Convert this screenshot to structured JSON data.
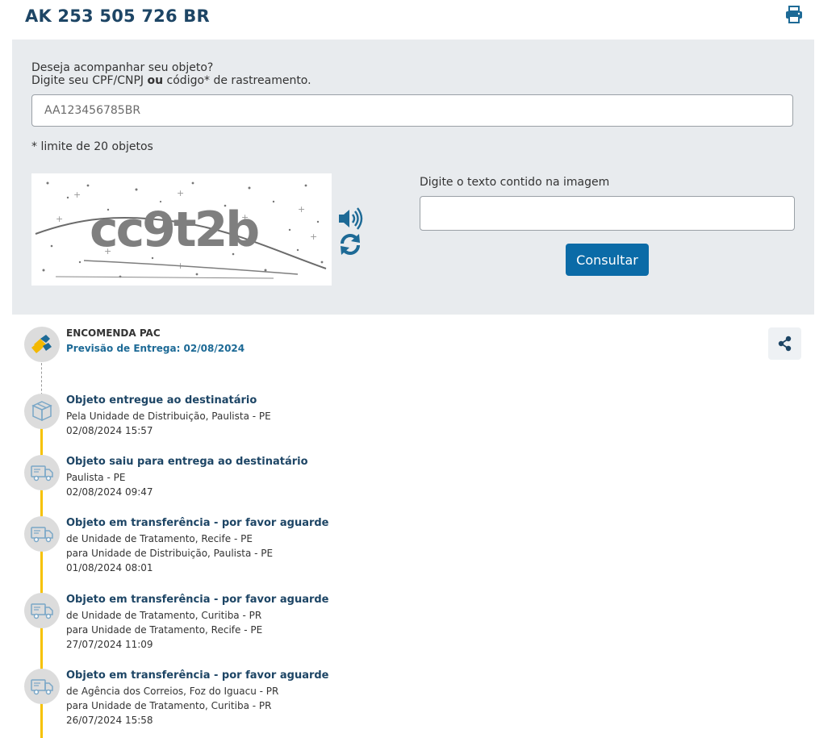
{
  "header": {
    "tracking_code": "AK 253 505 726 BR"
  },
  "search": {
    "prompt_line1": "Deseja acompanhar seu objeto?",
    "prompt_line2_pre": "Digite seu CPF/CNPJ ",
    "prompt_line2_bold": "ou",
    "prompt_line2_post": " código* de rastreamento.",
    "placeholder": "AA123456785BR",
    "limit_note": "* limite de 20 objetos",
    "captcha_text": "cc9t2b",
    "captcha_label": "Digite o texto contido na imagem",
    "consult_label": "Consultar"
  },
  "shipment": {
    "service": "ENCOMENDA PAC",
    "forecast": "Previsão de Entrega: 02/08/2024"
  },
  "events": [
    {
      "title": "Objeto entregue ao destinatário",
      "icon": "delivered-box-icon",
      "lines": [
        "Pela Unidade de Distribuição, Paulista - PE"
      ],
      "datetime": "02/08/2024 15:57"
    },
    {
      "title": "Objeto saiu para entrega ao destinatário",
      "icon": "delivery-truck-icon",
      "lines": [
        "Paulista - PE"
      ],
      "datetime": "02/08/2024 09:47"
    },
    {
      "title": "Objeto em transferência - por favor aguarde",
      "icon": "delivery-truck-icon",
      "lines": [
        "de Unidade de Tratamento, Recife - PE",
        "para Unidade de Distribuição, Paulista - PE"
      ],
      "datetime": "01/08/2024 08:01"
    },
    {
      "title": "Objeto em transferência - por favor aguarde",
      "icon": "delivery-truck-icon",
      "lines": [
        "de Unidade de Tratamento, Curitiba - PR",
        "para Unidade de Tratamento, Recife - PE"
      ],
      "datetime": "27/07/2024 11:09"
    },
    {
      "title": "Objeto em transferência - por favor aguarde",
      "icon": "delivery-truck-icon",
      "lines": [
        "de Agência dos Correios, Foz do Iguacu - PR",
        "para Unidade de Tratamento, Curitiba - PR"
      ],
      "datetime": "26/07/2024 15:58"
    }
  ],
  "colors": {
    "heading": "#1d4565",
    "accent_blue": "#0b6ba7",
    "timeline_yellow": "#f6c200",
    "panel_bg": "#e8ebee"
  }
}
